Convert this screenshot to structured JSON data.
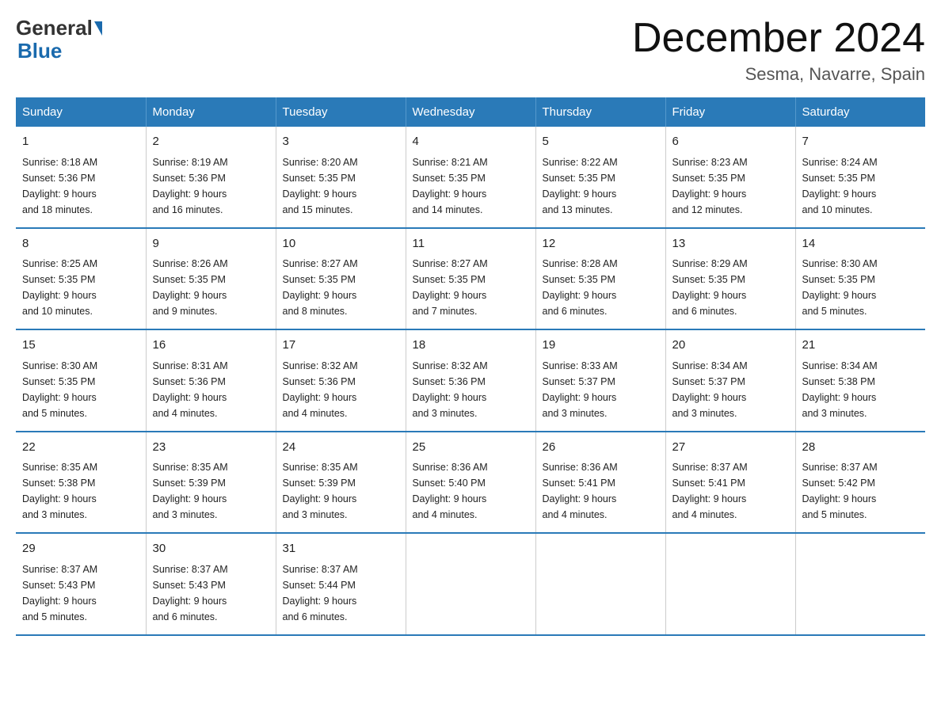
{
  "logo": {
    "general": "General",
    "blue": "Blue"
  },
  "title": "December 2024",
  "subtitle": "Sesma, Navarre, Spain",
  "days_header": [
    "Sunday",
    "Monday",
    "Tuesday",
    "Wednesday",
    "Thursday",
    "Friday",
    "Saturday"
  ],
  "weeks": [
    [
      {
        "day": "1",
        "sunrise": "8:18 AM",
        "sunset": "5:36 PM",
        "daylight": "9 hours and 18 minutes."
      },
      {
        "day": "2",
        "sunrise": "8:19 AM",
        "sunset": "5:36 PM",
        "daylight": "9 hours and 16 minutes."
      },
      {
        "day": "3",
        "sunrise": "8:20 AM",
        "sunset": "5:35 PM",
        "daylight": "9 hours and 15 minutes."
      },
      {
        "day": "4",
        "sunrise": "8:21 AM",
        "sunset": "5:35 PM",
        "daylight": "9 hours and 14 minutes."
      },
      {
        "day": "5",
        "sunrise": "8:22 AM",
        "sunset": "5:35 PM",
        "daylight": "9 hours and 13 minutes."
      },
      {
        "day": "6",
        "sunrise": "8:23 AM",
        "sunset": "5:35 PM",
        "daylight": "9 hours and 12 minutes."
      },
      {
        "day": "7",
        "sunrise": "8:24 AM",
        "sunset": "5:35 PM",
        "daylight": "9 hours and 10 minutes."
      }
    ],
    [
      {
        "day": "8",
        "sunrise": "8:25 AM",
        "sunset": "5:35 PM",
        "daylight": "9 hours and 10 minutes."
      },
      {
        "day": "9",
        "sunrise": "8:26 AM",
        "sunset": "5:35 PM",
        "daylight": "9 hours and 9 minutes."
      },
      {
        "day": "10",
        "sunrise": "8:27 AM",
        "sunset": "5:35 PM",
        "daylight": "9 hours and 8 minutes."
      },
      {
        "day": "11",
        "sunrise": "8:27 AM",
        "sunset": "5:35 PM",
        "daylight": "9 hours and 7 minutes."
      },
      {
        "day": "12",
        "sunrise": "8:28 AM",
        "sunset": "5:35 PM",
        "daylight": "9 hours and 6 minutes."
      },
      {
        "day": "13",
        "sunrise": "8:29 AM",
        "sunset": "5:35 PM",
        "daylight": "9 hours and 6 minutes."
      },
      {
        "day": "14",
        "sunrise": "8:30 AM",
        "sunset": "5:35 PM",
        "daylight": "9 hours and 5 minutes."
      }
    ],
    [
      {
        "day": "15",
        "sunrise": "8:30 AM",
        "sunset": "5:35 PM",
        "daylight": "9 hours and 5 minutes."
      },
      {
        "day": "16",
        "sunrise": "8:31 AM",
        "sunset": "5:36 PM",
        "daylight": "9 hours and 4 minutes."
      },
      {
        "day": "17",
        "sunrise": "8:32 AM",
        "sunset": "5:36 PM",
        "daylight": "9 hours and 4 minutes."
      },
      {
        "day": "18",
        "sunrise": "8:32 AM",
        "sunset": "5:36 PM",
        "daylight": "9 hours and 3 minutes."
      },
      {
        "day": "19",
        "sunrise": "8:33 AM",
        "sunset": "5:37 PM",
        "daylight": "9 hours and 3 minutes."
      },
      {
        "day": "20",
        "sunrise": "8:34 AM",
        "sunset": "5:37 PM",
        "daylight": "9 hours and 3 minutes."
      },
      {
        "day": "21",
        "sunrise": "8:34 AM",
        "sunset": "5:38 PM",
        "daylight": "9 hours and 3 minutes."
      }
    ],
    [
      {
        "day": "22",
        "sunrise": "8:35 AM",
        "sunset": "5:38 PM",
        "daylight": "9 hours and 3 minutes."
      },
      {
        "day": "23",
        "sunrise": "8:35 AM",
        "sunset": "5:39 PM",
        "daylight": "9 hours and 3 minutes."
      },
      {
        "day": "24",
        "sunrise": "8:35 AM",
        "sunset": "5:39 PM",
        "daylight": "9 hours and 3 minutes."
      },
      {
        "day": "25",
        "sunrise": "8:36 AM",
        "sunset": "5:40 PM",
        "daylight": "9 hours and 4 minutes."
      },
      {
        "day": "26",
        "sunrise": "8:36 AM",
        "sunset": "5:41 PM",
        "daylight": "9 hours and 4 minutes."
      },
      {
        "day": "27",
        "sunrise": "8:37 AM",
        "sunset": "5:41 PM",
        "daylight": "9 hours and 4 minutes."
      },
      {
        "day": "28",
        "sunrise": "8:37 AM",
        "sunset": "5:42 PM",
        "daylight": "9 hours and 5 minutes."
      }
    ],
    [
      {
        "day": "29",
        "sunrise": "8:37 AM",
        "sunset": "5:43 PM",
        "daylight": "9 hours and 5 minutes."
      },
      {
        "day": "30",
        "sunrise": "8:37 AM",
        "sunset": "5:43 PM",
        "daylight": "9 hours and 6 minutes."
      },
      {
        "day": "31",
        "sunrise": "8:37 AM",
        "sunset": "5:44 PM",
        "daylight": "9 hours and 6 minutes."
      },
      null,
      null,
      null,
      null
    ]
  ],
  "labels": {
    "sunrise": "Sunrise:",
    "sunset": "Sunset:",
    "daylight": "Daylight:"
  }
}
